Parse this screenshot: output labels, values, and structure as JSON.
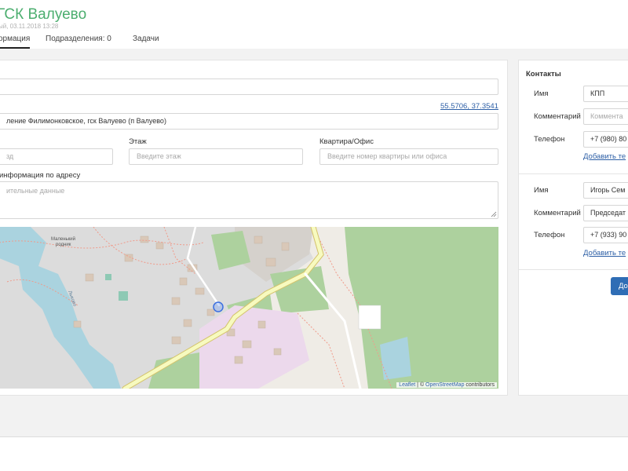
{
  "header": {
    "title": "ГСК Валуево",
    "subtitle": "ый, 03.11.2018 13:28"
  },
  "tabs": [
    {
      "label": "ормация",
      "active": true
    },
    {
      "label": "Подразделения: 0",
      "active": false
    },
    {
      "label": "Задачи",
      "active": false
    }
  ],
  "address": {
    "coords_link": "55.5706, 37.3541",
    "address_value": "ление Филимонковское, гск Валуево (п Валуево)",
    "entrance_placeholder": "зд",
    "floor_label": "Этаж",
    "floor_placeholder": "Введите этаж",
    "apartment_label": "Квартира/Офис",
    "apartment_placeholder": "Введите номер квартиры или офиса",
    "extra_label": "информация по адресу",
    "extra_placeholder": "ительные данные"
  },
  "map": {
    "place_label_1": "Маленький",
    "place_label_2": "родник",
    "river_label": "Лыково",
    "attribution_leaflet": "Leaflet",
    "attribution_sep": " | © ",
    "attribution_osm": "OpenStreetMap",
    "attribution_tail": " contributors",
    "colors": {
      "water": "#aad3df",
      "forest": "#add19e",
      "residential": "#d9d9d9",
      "road": "#f7fabf",
      "road_edge": "#d4c36b",
      "pink": "#ecd9ec"
    }
  },
  "contacts": {
    "title": "Контакты",
    "entries": [
      {
        "name_label": "Имя",
        "name_value": "КПП",
        "comment_label": "Комментарий",
        "comment_placeholder": "Коммента",
        "phone_label": "Телефон",
        "phone_value": "+7 (980) 80",
        "add_phone_link": "Добавить те"
      },
      {
        "name_label": "Имя",
        "name_value": "Игорь Сем",
        "comment_label": "Комментарий",
        "comment_value": "Председат",
        "phone_label": "Телефон",
        "phone_value": "+7 (933) 90",
        "add_phone_link": "Добавить те"
      }
    ],
    "add_button": "До"
  }
}
